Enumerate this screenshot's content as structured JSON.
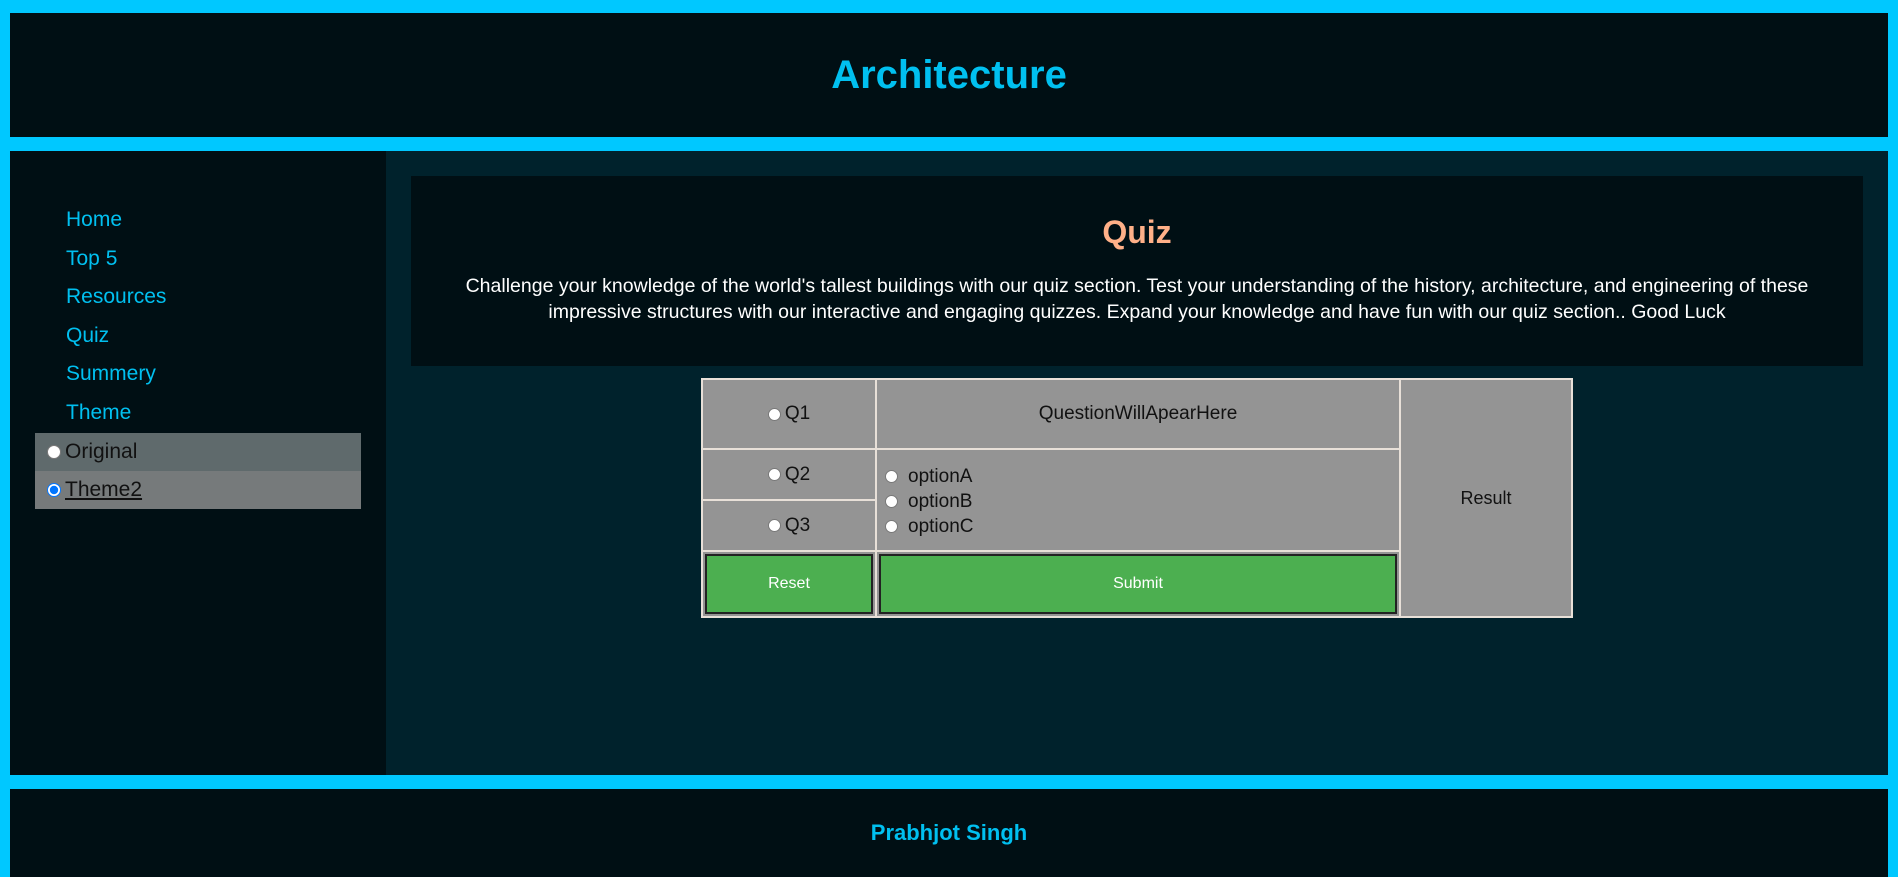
{
  "header": {
    "title": "Architecture"
  },
  "sidebar": {
    "nav": [
      "Home",
      "Top 5",
      "Resources",
      "Quiz",
      "Summery",
      "Theme"
    ],
    "themes": [
      {
        "label": "Original",
        "selected": false
      },
      {
        "label": "Theme2",
        "selected": true
      }
    ]
  },
  "intro": {
    "title": "Quiz",
    "text": "Challenge your knowledge of the world's tallest buildings with our quiz section. Test your understanding of the history, architecture, and engineering of these impressive structures with our interactive and engaging quizzes. Expand your knowledge and have fun with our quiz section.. Good Luck"
  },
  "quiz": {
    "questions": [
      "Q1",
      "Q2",
      "Q3"
    ],
    "question_text": "QuestionWillApearHere",
    "options": [
      "optionA",
      "optionB",
      "optionC"
    ],
    "reset_label": "Reset",
    "submit_label": "Submit",
    "result_label": "Result"
  },
  "footer": {
    "author": "Prabhjot Singh"
  },
  "colors": {
    "accent": "#00c8ff",
    "panel": "#000f14",
    "main_bg": "#00222c",
    "quiz_title": "#ffb088",
    "button": "#4caf50"
  }
}
